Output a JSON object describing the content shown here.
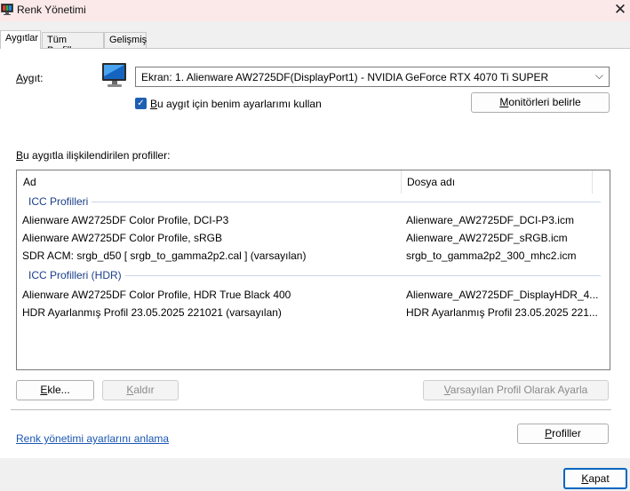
{
  "window": {
    "title": "Renk Yönetimi",
    "close_glyph": "✕",
    "app_icon": "color-management-icon"
  },
  "tabs": [
    {
      "label": "Aygıtlar",
      "active": true
    },
    {
      "label": "Tüm Profiller",
      "active": false
    },
    {
      "label": "Gelişmiş",
      "active": false
    }
  ],
  "device": {
    "label_u": "A",
    "label_rest": "ygıt:",
    "icon": "monitor-icon",
    "selected": "Ekran: 1. Alienware AW2725DF(DisplayPort1) - NVIDIA GeForce RTX 4070 Ti SUPER",
    "chevron": "⌵",
    "use_my_settings_u": "B",
    "use_my_settings_rest": "u aygıt için benim ayarlarımı kullan",
    "use_my_settings_checked": true,
    "identify_u": "M",
    "identify_rest": "onitörleri belirle"
  },
  "profiles": {
    "label_u": "B",
    "label_rest": "u aygıtla ilişkilendirilen profiller:",
    "columns": [
      "Ad",
      "Dosya adı"
    ],
    "groups": [
      {
        "title": "ICC Profilleri",
        "rows": [
          {
            "name": "Alienware AW2725DF Color Profile, DCI-P3",
            "file": "Alienware_AW2725DF_DCI-P3.icm"
          },
          {
            "name": "Alienware AW2725DF Color Profile, sRGB",
            "file": "Alienware_AW2725DF_sRGB.icm"
          },
          {
            "name": "SDR ACM: srgb_d50 [ srgb_to_gamma2p2.cal ] (varsayılan)",
            "file": "srgb_to_gamma2p2_300_mhc2.icm"
          }
        ]
      },
      {
        "title": "ICC Profilleri (HDR)",
        "rows": [
          {
            "name": "Alienware AW2725DF Color Profile, HDR True Black 400",
            "file": "Alienware_AW2725DF_DisplayHDR_4..."
          },
          {
            "name": "HDR Ayarlanmış Profil 23.05.2025 221021 (varsayılan)",
            "file": "HDR Ayarlanmış Profil 23.05.2025 221..."
          }
        ]
      }
    ]
  },
  "buttons": {
    "add_u": "E",
    "add_rest": "kle...",
    "remove_u": "K",
    "remove_rest": "aldır",
    "set_default_u": "V",
    "set_default_rest": "arsayılan Profil Olarak Ayarla",
    "profiles_u": "P",
    "profiles_rest": "rofiller",
    "close_u": "K",
    "close_rest": "apat"
  },
  "link": {
    "text": "Renk yönetimi ayarlarını anlama"
  }
}
